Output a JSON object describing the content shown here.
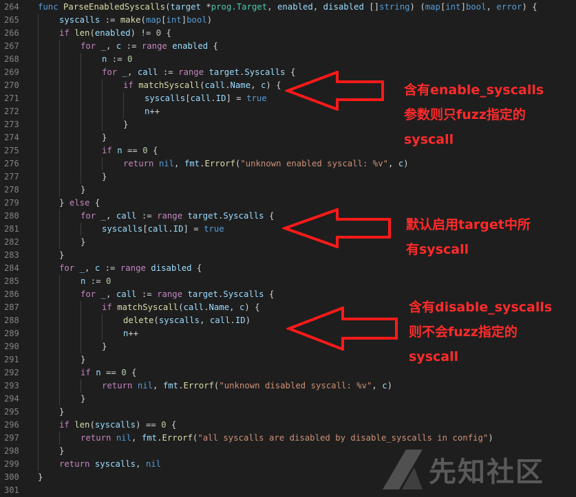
{
  "editor": {
    "lines": [
      {
        "no": "264",
        "indent": 0,
        "tokens": [
          [
            "kw",
            "func "
          ],
          [
            "fn",
            "ParseEnabledSyscalls"
          ],
          [
            "plain",
            "("
          ],
          [
            "var",
            "target"
          ],
          [
            "plain",
            " *"
          ],
          [
            "ty",
            "prog.Target"
          ],
          [
            "plain",
            ", "
          ],
          [
            "var",
            "enabled"
          ],
          [
            "plain",
            ", "
          ],
          [
            "var",
            "disabled"
          ],
          [
            "plain",
            " []"
          ],
          [
            "kw",
            "string"
          ],
          [
            "plain",
            ") ("
          ],
          [
            "kw",
            "map"
          ],
          [
            "plain",
            "["
          ],
          [
            "kw",
            "int"
          ],
          [
            "plain",
            "]"
          ],
          [
            "kw",
            "bool"
          ],
          [
            "plain",
            ", "
          ],
          [
            "kw",
            "error"
          ],
          [
            "plain",
            ") {"
          ]
        ]
      },
      {
        "no": "265",
        "indent": 1,
        "tokens": [
          [
            "var",
            "syscalls"
          ],
          [
            "plain",
            " := "
          ],
          [
            "fn",
            "make"
          ],
          [
            "plain",
            "("
          ],
          [
            "kw",
            "map"
          ],
          [
            "plain",
            "["
          ],
          [
            "kw",
            "int"
          ],
          [
            "plain",
            "]"
          ],
          [
            "kw",
            "bool"
          ],
          [
            "plain",
            ")"
          ]
        ]
      },
      {
        "no": "266",
        "indent": 1,
        "tokens": [
          [
            "ctl",
            "if "
          ],
          [
            "fn",
            "len"
          ],
          [
            "plain",
            "("
          ],
          [
            "var",
            "enabled"
          ],
          [
            "plain",
            ") != "
          ],
          [
            "num",
            "0"
          ],
          [
            "plain",
            " {"
          ]
        ]
      },
      {
        "no": "267",
        "indent": 2,
        "tokens": [
          [
            "ctl",
            "for "
          ],
          [
            "var",
            "_"
          ],
          [
            "plain",
            ", "
          ],
          [
            "var",
            "c"
          ],
          [
            "plain",
            " := "
          ],
          [
            "ctl",
            "range "
          ],
          [
            "var",
            "enabled"
          ],
          [
            "plain",
            " {"
          ]
        ]
      },
      {
        "no": "268",
        "indent": 3,
        "tokens": [
          [
            "var",
            "n"
          ],
          [
            "plain",
            " := "
          ],
          [
            "num",
            "0"
          ]
        ]
      },
      {
        "no": "269",
        "indent": 3,
        "tokens": [
          [
            "ctl",
            "for "
          ],
          [
            "var",
            "_"
          ],
          [
            "plain",
            ", "
          ],
          [
            "var",
            "call"
          ],
          [
            "plain",
            " := "
          ],
          [
            "ctl",
            "range "
          ],
          [
            "var",
            "target"
          ],
          [
            "plain",
            "."
          ],
          [
            "var",
            "Syscalls"
          ],
          [
            "plain",
            " {"
          ]
        ]
      },
      {
        "no": "270",
        "indent": 4,
        "tokens": [
          [
            "ctl",
            "if "
          ],
          [
            "fn",
            "matchSyscall"
          ],
          [
            "plain",
            "("
          ],
          [
            "var",
            "call"
          ],
          [
            "plain",
            "."
          ],
          [
            "var",
            "Name"
          ],
          [
            "plain",
            ", "
          ],
          [
            "var",
            "c"
          ],
          [
            "plain",
            ") {"
          ]
        ]
      },
      {
        "no": "271",
        "indent": 5,
        "tokens": [
          [
            "var",
            "syscalls"
          ],
          [
            "plain",
            "["
          ],
          [
            "var",
            "call"
          ],
          [
            "plain",
            "."
          ],
          [
            "var",
            "ID"
          ],
          [
            "plain",
            "] = "
          ],
          [
            "kw",
            "true"
          ]
        ]
      },
      {
        "no": "272",
        "indent": 5,
        "tokens": [
          [
            "var",
            "n"
          ],
          [
            "plain",
            "++"
          ]
        ]
      },
      {
        "no": "273",
        "indent": 4,
        "tokens": [
          [
            "plain",
            "}"
          ]
        ]
      },
      {
        "no": "274",
        "indent": 3,
        "tokens": [
          [
            "plain",
            "}"
          ]
        ]
      },
      {
        "no": "275",
        "indent": 3,
        "tokens": [
          [
            "ctl",
            "if "
          ],
          [
            "var",
            "n"
          ],
          [
            "plain",
            " == "
          ],
          [
            "num",
            "0"
          ],
          [
            "plain",
            " {"
          ]
        ]
      },
      {
        "no": "276",
        "indent": 4,
        "tokens": [
          [
            "ctl",
            "return "
          ],
          [
            "kw",
            "nil"
          ],
          [
            "plain",
            ", "
          ],
          [
            "var",
            "fmt"
          ],
          [
            "plain",
            "."
          ],
          [
            "fn",
            "Errorf"
          ],
          [
            "plain",
            "("
          ],
          [
            "str",
            "\"unknown enabled syscall: %v\""
          ],
          [
            "plain",
            ", "
          ],
          [
            "var",
            "c"
          ],
          [
            "plain",
            ")"
          ]
        ]
      },
      {
        "no": "277",
        "indent": 3,
        "tokens": [
          [
            "plain",
            "}"
          ]
        ]
      },
      {
        "no": "278",
        "indent": 2,
        "tokens": [
          [
            "plain",
            "}"
          ]
        ]
      },
      {
        "no": "279",
        "indent": 1,
        "tokens": [
          [
            "plain",
            "} "
          ],
          [
            "ctl",
            "else"
          ],
          [
            "plain",
            " {"
          ]
        ]
      },
      {
        "no": "280",
        "indent": 2,
        "tokens": [
          [
            "ctl",
            "for "
          ],
          [
            "var",
            "_"
          ],
          [
            "plain",
            ", "
          ],
          [
            "var",
            "call"
          ],
          [
            "plain",
            " := "
          ],
          [
            "ctl",
            "range "
          ],
          [
            "var",
            "target"
          ],
          [
            "plain",
            "."
          ],
          [
            "var",
            "Syscalls"
          ],
          [
            "plain",
            " {"
          ]
        ]
      },
      {
        "no": "281",
        "indent": 3,
        "tokens": [
          [
            "var",
            "syscalls"
          ],
          [
            "plain",
            "["
          ],
          [
            "var",
            "call"
          ],
          [
            "plain",
            "."
          ],
          [
            "var",
            "ID"
          ],
          [
            "plain",
            "] = "
          ],
          [
            "kw",
            "true"
          ]
        ]
      },
      {
        "no": "282",
        "indent": 2,
        "tokens": [
          [
            "plain",
            "}"
          ]
        ]
      },
      {
        "no": "283",
        "indent": 1,
        "tokens": [
          [
            "plain",
            "}"
          ]
        ]
      },
      {
        "no": "284",
        "indent": 1,
        "tokens": [
          [
            "ctl",
            "for "
          ],
          [
            "var",
            "_"
          ],
          [
            "plain",
            ", "
          ],
          [
            "var",
            "c"
          ],
          [
            "plain",
            " := "
          ],
          [
            "ctl",
            "range "
          ],
          [
            "var",
            "disabled"
          ],
          [
            "plain",
            " {"
          ]
        ]
      },
      {
        "no": "285",
        "indent": 2,
        "tokens": [
          [
            "var",
            "n"
          ],
          [
            "plain",
            " := "
          ],
          [
            "num",
            "0"
          ]
        ]
      },
      {
        "no": "286",
        "indent": 2,
        "tokens": [
          [
            "ctl",
            "for "
          ],
          [
            "var",
            "_"
          ],
          [
            "plain",
            ", "
          ],
          [
            "var",
            "call"
          ],
          [
            "plain",
            " := "
          ],
          [
            "ctl",
            "range "
          ],
          [
            "var",
            "target"
          ],
          [
            "plain",
            "."
          ],
          [
            "var",
            "Syscalls"
          ],
          [
            "plain",
            " {"
          ]
        ]
      },
      {
        "no": "287",
        "indent": 3,
        "tokens": [
          [
            "ctl",
            "if "
          ],
          [
            "fn",
            "matchSyscall"
          ],
          [
            "plain",
            "("
          ],
          [
            "var",
            "call"
          ],
          [
            "plain",
            "."
          ],
          [
            "var",
            "Name"
          ],
          [
            "plain",
            ", "
          ],
          [
            "var",
            "c"
          ],
          [
            "plain",
            ") {"
          ]
        ]
      },
      {
        "no": "288",
        "indent": 4,
        "tokens": [
          [
            "fn",
            "delete"
          ],
          [
            "plain",
            "("
          ],
          [
            "var",
            "syscalls"
          ],
          [
            "plain",
            ", "
          ],
          [
            "var",
            "call"
          ],
          [
            "plain",
            "."
          ],
          [
            "var",
            "ID"
          ],
          [
            "plain",
            ")"
          ]
        ]
      },
      {
        "no": "289",
        "indent": 4,
        "tokens": [
          [
            "var",
            "n"
          ],
          [
            "plain",
            "++"
          ]
        ]
      },
      {
        "no": "290",
        "indent": 3,
        "tokens": [
          [
            "plain",
            "}"
          ]
        ]
      },
      {
        "no": "291",
        "indent": 2,
        "tokens": [
          [
            "plain",
            "}"
          ]
        ]
      },
      {
        "no": "292",
        "indent": 2,
        "tokens": [
          [
            "ctl",
            "if "
          ],
          [
            "var",
            "n"
          ],
          [
            "plain",
            " == "
          ],
          [
            "num",
            "0"
          ],
          [
            "plain",
            " {"
          ]
        ]
      },
      {
        "no": "293",
        "indent": 3,
        "tokens": [
          [
            "ctl",
            "return "
          ],
          [
            "kw",
            "nil"
          ],
          [
            "plain",
            ", "
          ],
          [
            "var",
            "fmt"
          ],
          [
            "plain",
            "."
          ],
          [
            "fn",
            "Errorf"
          ],
          [
            "plain",
            "("
          ],
          [
            "str",
            "\"unknown disabled syscall: %v\""
          ],
          [
            "plain",
            ", "
          ],
          [
            "var",
            "c"
          ],
          [
            "plain",
            ")"
          ]
        ]
      },
      {
        "no": "294",
        "indent": 2,
        "tokens": [
          [
            "plain",
            "}"
          ]
        ]
      },
      {
        "no": "295",
        "indent": 1,
        "tokens": [
          [
            "plain",
            "}"
          ]
        ]
      },
      {
        "no": "296",
        "indent": 1,
        "tokens": [
          [
            "ctl",
            "if "
          ],
          [
            "fn",
            "len"
          ],
          [
            "plain",
            "("
          ],
          [
            "var",
            "syscalls"
          ],
          [
            "plain",
            ") == "
          ],
          [
            "num",
            "0"
          ],
          [
            "plain",
            " {"
          ]
        ]
      },
      {
        "no": "297",
        "indent": 2,
        "tokens": [
          [
            "ctl",
            "return "
          ],
          [
            "kw",
            "nil"
          ],
          [
            "plain",
            ", "
          ],
          [
            "var",
            "fmt"
          ],
          [
            "plain",
            "."
          ],
          [
            "fn",
            "Errorf"
          ],
          [
            "plain",
            "("
          ],
          [
            "str",
            "\"all syscalls are disabled by disable_syscalls in config\""
          ],
          [
            "plain",
            ")"
          ]
        ]
      },
      {
        "no": "298",
        "indent": 1,
        "tokens": [
          [
            "plain",
            "}"
          ]
        ]
      },
      {
        "no": "299",
        "indent": 1,
        "tokens": [
          [
            "ctl",
            "return "
          ],
          [
            "var",
            "syscalls"
          ],
          [
            "plain",
            ", "
          ],
          [
            "kw",
            "nil"
          ]
        ]
      },
      {
        "no": "300",
        "indent": 0,
        "tokens": [
          [
            "plain",
            "}"
          ]
        ]
      },
      {
        "no": "301",
        "indent": 0,
        "tokens": []
      }
    ]
  },
  "annotations": [
    {
      "lines": [
        "含有enable_syscalls",
        "参数则只fuzz指定的",
        "syscall"
      ]
    },
    {
      "lines": [
        "默认启用target中所",
        "有syscall"
      ]
    },
    {
      "lines": [
        "含有disable_syscalls",
        "则不会fuzz指定的",
        "syscall"
      ]
    }
  ],
  "watermark": {
    "text": "先知社区"
  },
  "colors": {
    "background": "#1e1e1e",
    "annotation": "#ff2b2b",
    "keyword": "#569cd6",
    "control": "#c586c0",
    "function": "#dcdcaa",
    "type": "#4ec9b0",
    "string": "#ce9178",
    "number": "#b5cea8",
    "variable": "#9cdcfe"
  }
}
